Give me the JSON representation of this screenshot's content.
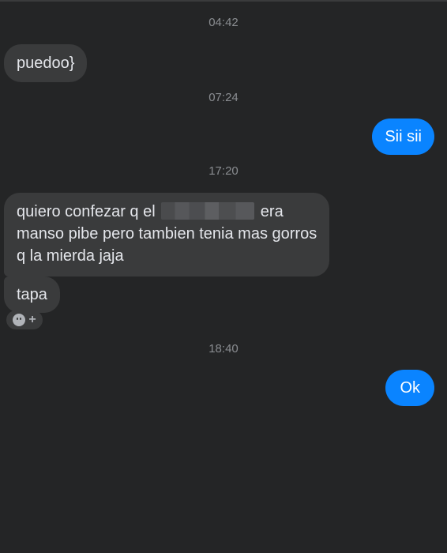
{
  "messages": [
    {
      "time": "04:42"
    },
    {
      "text": "puedoo}"
    },
    {
      "time": "07:24"
    },
    {
      "text": "Sii sii"
    },
    {
      "time": "17:20"
    },
    {
      "line1_a": "quiero confezar  q el",
      "line1_b": "era",
      "line2": "manso pibe pero tambien tenia mas gorros",
      "line3": "q la mierda jaja"
    },
    {
      "text": "tapa"
    },
    {
      "time": "18:40"
    },
    {
      "text": "Ok"
    }
  ],
  "reaction_icons": [
    "smiley-icon",
    "plus-icon"
  ],
  "colors": {
    "background": "#242526",
    "incoming": "#3a3b3c",
    "outgoing": "#0a84ff",
    "timestamp": "#8a8d91"
  }
}
